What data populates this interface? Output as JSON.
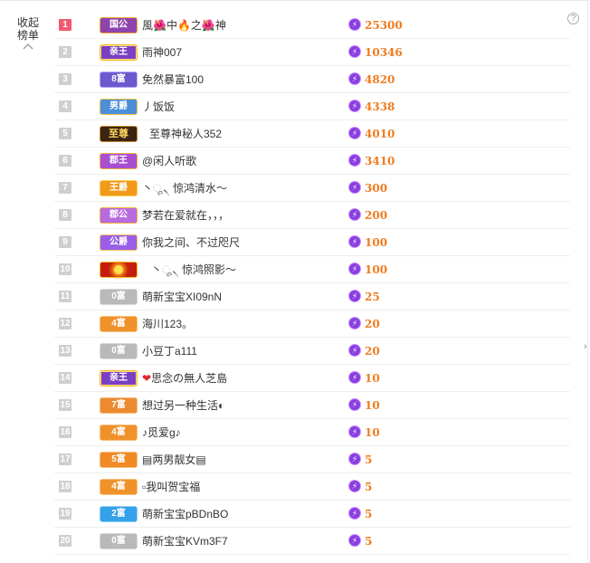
{
  "sidebar": {
    "collapse_line1": "收起",
    "collapse_line2": "榜单",
    "chevron_icon": "chevron-up-icon"
  },
  "help_icon": "?",
  "side_arrow": "›",
  "colors": {
    "rank_top": "#f05a6e",
    "rank_default": "#cfcfcf",
    "count": "#ee7b1f",
    "energy": "#8a3ee0"
  },
  "rows": [
    {
      "rank": "1",
      "badge": "国公",
      "name": "風🌺中🔥之🌺神",
      "count": "25300"
    },
    {
      "rank": "2",
      "badge": "亲王",
      "name": "雨神007",
      "count": "10346"
    },
    {
      "rank": "3",
      "badge": "8富",
      "name": "免然暴富100",
      "count": "4820"
    },
    {
      "rank": "4",
      "badge": "男爵",
      "name": "丿饭饭",
      "count": "4338"
    },
    {
      "rank": "5",
      "badge": "至尊",
      "name": "至尊神秘人352",
      "count": "4010"
    },
    {
      "rank": "6",
      "badge": "郡王",
      "name": "@闲人听歌",
      "count": "3410"
    },
    {
      "rank": "7",
      "badge": "王爵",
      "name": "丶ೄ৲ 惊鸿清水～",
      "count": "300"
    },
    {
      "rank": "8",
      "badge": "郡公",
      "name": "梦若在爱就在，，，",
      "count": "200"
    },
    {
      "rank": "9",
      "badge": "公爵",
      "name": "你我之间、不过咫尺",
      "count": "100"
    },
    {
      "rank": "10",
      "badge": "",
      "name": "丶ೄ৲ 惊鸿照影～",
      "count": "100"
    },
    {
      "rank": "11",
      "badge": "0富",
      "name": "萌新宝宝XI09nN",
      "count": "25"
    },
    {
      "rank": "12",
      "badge": "4富",
      "name": "海川123。",
      "count": "20"
    },
    {
      "rank": "13",
      "badge": "0富",
      "name": "小豆丁a111",
      "count": "20"
    },
    {
      "rank": "14",
      "badge": "亲王",
      "name": "思念の無人芝島",
      "count": "10"
    },
    {
      "rank": "15",
      "badge": "7富",
      "name": "想过另一种生活◐",
      "count": "10"
    },
    {
      "rank": "16",
      "badge": "4富",
      "name": "♪觅爱g♪",
      "count": "10"
    },
    {
      "rank": "17",
      "badge": "5富",
      "name": "▤两男靓女▤",
      "count": "5"
    },
    {
      "rank": "18",
      "badge": "4富",
      "name": "▫我叫贺宝福",
      "count": "5"
    },
    {
      "rank": "19",
      "badge": "2富",
      "name": "萌新宝宝pBDnBO",
      "count": "5"
    },
    {
      "rank": "20",
      "badge": "0富",
      "name": "萌新宝宝KVm3F7",
      "count": "5"
    }
  ]
}
